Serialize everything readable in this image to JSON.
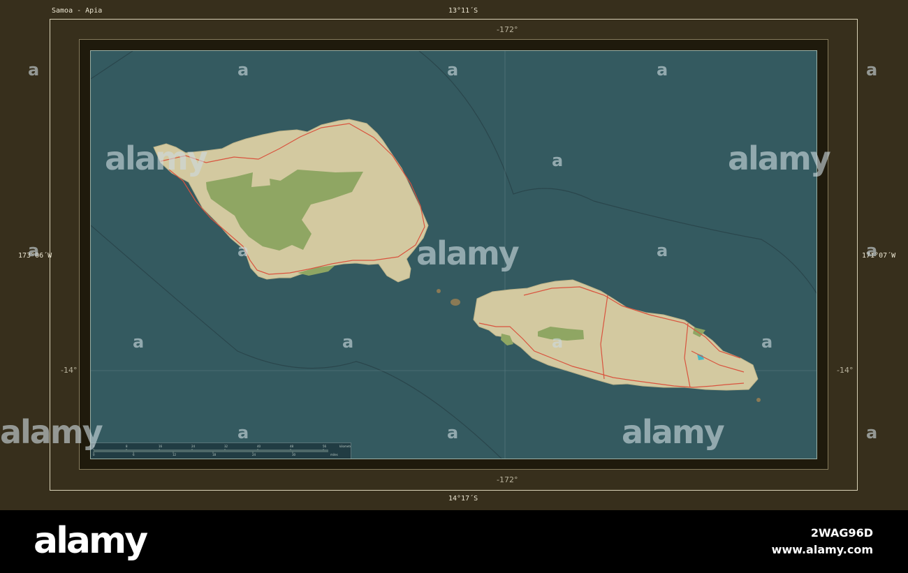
{
  "title": "Samoa - Apia",
  "bounds": {
    "north": "13°11´S",
    "south": "14°17´S",
    "west": "173°06´W",
    "east": "171°07´W"
  },
  "graticule": {
    "lon_top": "-172°",
    "lon_bottom": "-172°",
    "lat_left": "-14°",
    "lat_right": "-14°"
  },
  "scale": {
    "top_label": "kilometers",
    "bottom_label": "miles",
    "km_ticks": [
      "0",
      "8",
      "16",
      "24",
      "32",
      "40",
      "48",
      "56"
    ],
    "mi_ticks": [
      "0",
      "6",
      "12",
      "18",
      "24",
      "30"
    ]
  },
  "colors": {
    "ocean": "#345a60",
    "land": "#d3c9a0",
    "forest": "#8fa663",
    "roads": "#d9533e",
    "frame": "#372f1c"
  },
  "watermark": {
    "word": "alamy",
    "glyph": "a"
  },
  "footer": {
    "brand": "alamy",
    "image_id": "2WAG96D",
    "site": "www.alamy.com"
  }
}
